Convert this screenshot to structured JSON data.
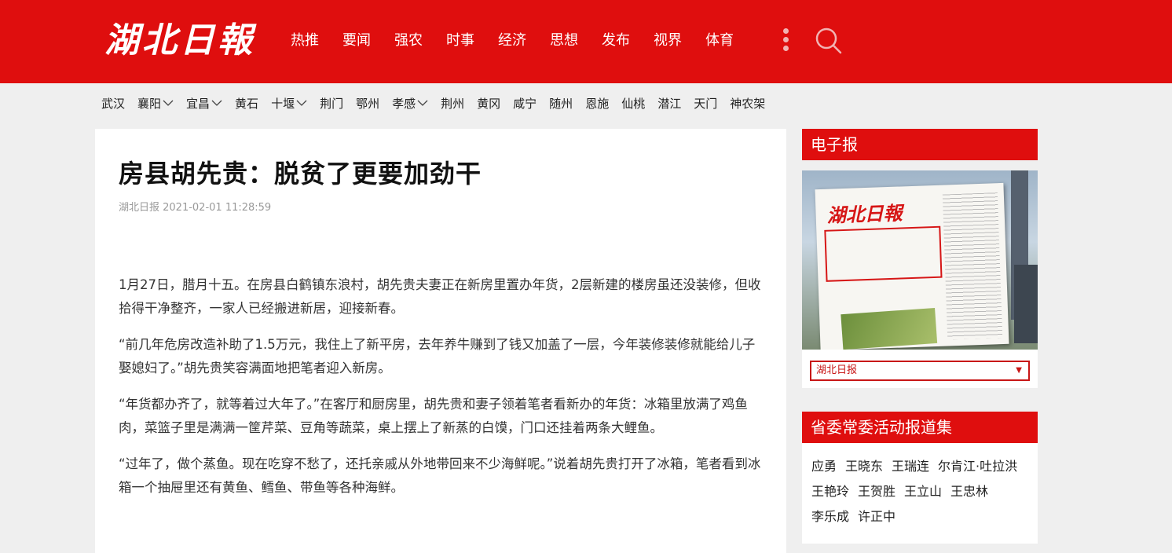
{
  "header": {
    "logo": "湖北日報",
    "nav": [
      "热推",
      "要闻",
      "强农",
      "时事",
      "经济",
      "思想",
      "发布",
      "视界",
      "体育"
    ]
  },
  "regions": [
    {
      "label": "武汉",
      "dropdown": false
    },
    {
      "label": "襄阳",
      "dropdown": true
    },
    {
      "label": "宜昌",
      "dropdown": true
    },
    {
      "label": "黄石",
      "dropdown": false
    },
    {
      "label": "十堰",
      "dropdown": true
    },
    {
      "label": "荆门",
      "dropdown": false
    },
    {
      "label": "鄂州",
      "dropdown": false
    },
    {
      "label": "孝感",
      "dropdown": true
    },
    {
      "label": "荆州",
      "dropdown": false
    },
    {
      "label": "黄冈",
      "dropdown": false
    },
    {
      "label": "咸宁",
      "dropdown": false
    },
    {
      "label": "随州",
      "dropdown": false
    },
    {
      "label": "恩施",
      "dropdown": false
    },
    {
      "label": "仙桃",
      "dropdown": false
    },
    {
      "label": "潜江",
      "dropdown": false
    },
    {
      "label": "天门",
      "dropdown": false
    },
    {
      "label": "神农架",
      "dropdown": false
    }
  ],
  "article": {
    "title": "房县胡先贵：脱贫了更要加劲干",
    "meta": "湖北日报 2021-02-01 11:28:59",
    "paragraphs": [
      "1月27日，腊月十五。在房县白鹤镇东浪村，胡先贵夫妻正在新房里置办年货，2层新建的楼房虽还没装修，但收拾得干净整齐，一家人已经搬进新居，迎接新春。",
      "“前几年危房改造补助了1.5万元，我住上了新平房，去年养牛赚到了钱又加盖了一层，今年装修装修就能给儿子娶媳妇了。”胡先贵笑容满面地把笔者迎入新房。",
      "“年货都办齐了，就等着过大年了。”在客厅和厨房里，胡先贵和妻子领着笔者看新办的年货：冰箱里放满了鸡鱼肉，菜篮子里是满满一筐芹菜、豆角等蔬菜，桌上摆上了新蒸的白馍，门口还挂着两条大鲤鱼。",
      "“过年了，做个蒸鱼。现在吃穿不愁了，还托亲戚从外地带回来不少海鲜呢。”说着胡先贵打开了冰箱，笔者看到冰箱一个抽屉里还有黄鱼、鳕鱼、带鱼等各种海鲜。"
    ]
  },
  "sidebar": {
    "epaper_title": "电子报",
    "epaper_logo": "湖北日報",
    "epaper_select": "湖北日报",
    "leaders_title": "省委常委活动报道集",
    "leaders": [
      "应勇",
      "王晓东",
      "王瑞连",
      "尔肯江·吐拉洪",
      "王艳玲",
      "王贺胜",
      "王立山",
      "王忠林",
      "李乐成",
      "许正中"
    ]
  },
  "colors": {
    "brand_red": "#df0e0e"
  }
}
